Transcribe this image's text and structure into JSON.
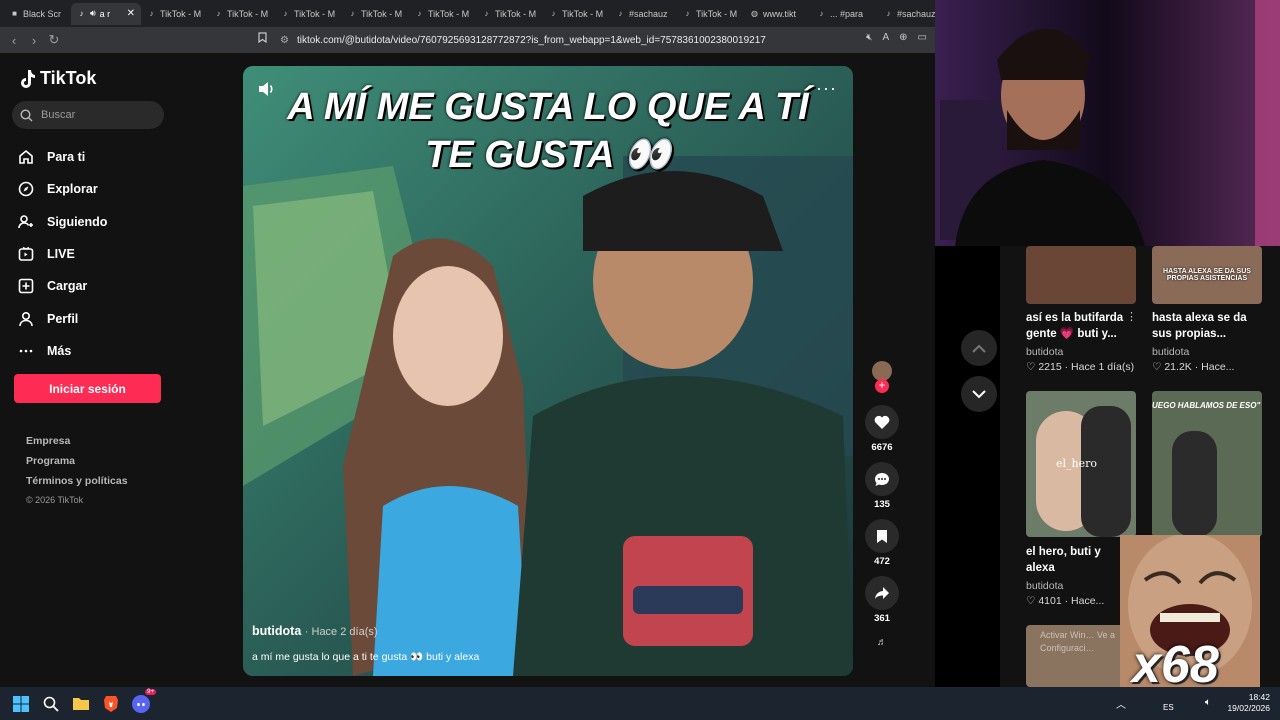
{
  "browser": {
    "tabs": [
      {
        "label": "Black Scr",
        "icon": "black-square-icon"
      },
      {
        "label": "a r",
        "icon": "tiktok-icon",
        "active": true
      },
      {
        "label": "TikTok - M",
        "icon": "tiktok-icon"
      },
      {
        "label": "TikTok - M",
        "icon": "tiktok-icon"
      },
      {
        "label": "TikTok - M",
        "icon": "tiktok-icon"
      },
      {
        "label": "TikTok - M",
        "icon": "tiktok-icon"
      },
      {
        "label": "TikTok - M",
        "icon": "tiktok-icon"
      },
      {
        "label": "TikTok - M",
        "icon": "tiktok-icon"
      },
      {
        "label": "TikTok - M",
        "icon": "tiktok-icon"
      },
      {
        "label": "#sachauz",
        "icon": "tiktok-icon"
      },
      {
        "label": "TikTok - M",
        "icon": "tiktok-icon"
      },
      {
        "label": "www.tikt",
        "icon": "globe-icon"
      },
      {
        "label": "... #para",
        "icon": "tiktok-icon"
      },
      {
        "label": "#sachauz",
        "icon": "tiktok-icon"
      }
    ],
    "url": "tiktok.com/@butidota/video/7607925693128772872?is_from_webapp=1&web_id=7578361002380019217"
  },
  "sidebar": {
    "logo": "TikTok",
    "search_placeholder": "Buscar",
    "nav": [
      {
        "label": "Para ti",
        "icon": "home-icon"
      },
      {
        "label": "Explorar",
        "icon": "compass-icon"
      },
      {
        "label": "Siguiendo",
        "icon": "following-icon"
      },
      {
        "label": "LIVE",
        "icon": "live-icon"
      },
      {
        "label": "Cargar",
        "icon": "upload-icon"
      },
      {
        "label": "Perfil",
        "icon": "profile-icon"
      },
      {
        "label": "Más",
        "icon": "more-icon"
      }
    ],
    "login_label": "Iniciar sesión",
    "footer": [
      "Empresa",
      "Programa",
      "Términos y políticas"
    ],
    "copyright": "© 2026 TikTok"
  },
  "video": {
    "caption_line1": "A MÍ ME GUSTA LO QUE A TÍ",
    "caption_line2": "TE GUSTA 👀",
    "author": "butidota",
    "date": "· Hace 2 día(s)",
    "description": "a mí me gusta lo que a ti te gusta 👀 buti y alexa",
    "likes": "6676",
    "comments": "135",
    "saves": "472",
    "shares": "361"
  },
  "recommendations": [
    {
      "title": "así es la butifarda gente 💗 buti y...",
      "author": "butidota",
      "likes": "2215",
      "time": "Hace 1 día(s)"
    },
    {
      "title": "hasta alexa se da sus propias...",
      "author": "butidota",
      "likes": "21.2K",
      "time": "Hace...",
      "overlay": "HASTA ALEXA SE DA SUS PROPIAS ASISTENCIAS"
    },
    {
      "title": "el hero, buti y alexa",
      "author": "butidota",
      "likes": "4101",
      "time": "Hace...",
      "overlay": "el_hero"
    },
    {
      "title": "",
      "author": "",
      "likes": "",
      "time": "",
      "overlay": "UEGO HABLAMOS DE ESO\""
    }
  ],
  "watermark": "Activar Win… Ve a Configuraci…",
  "meme_text": "x68",
  "taskbar": {
    "lang": "ES",
    "time": "18:42",
    "date": "19/02/2026",
    "badge": "9+"
  },
  "colors": {
    "accent": "#fe2c55",
    "bg": "#121212"
  }
}
